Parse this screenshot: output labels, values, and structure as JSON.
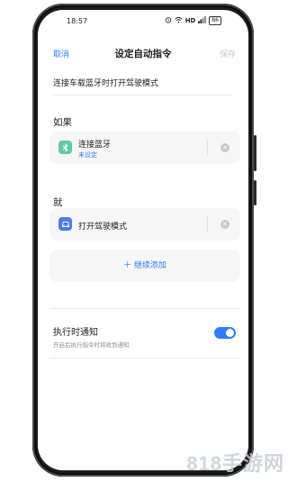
{
  "status_bar": {
    "time": "18:57",
    "network": "HD",
    "battery": "86"
  },
  "header": {
    "cancel_label": "取消",
    "title": "设定自动指令",
    "save_label": "保存"
  },
  "command_name": {
    "value": "连接车载蓝牙时打开驾驶模式"
  },
  "condition": {
    "section_label": "如果",
    "item": {
      "title": "连接蓝牙",
      "subtitle": "未设定",
      "icon": "bluetooth-icon",
      "icon_color": "#5fc9a3"
    }
  },
  "action": {
    "section_label": "就",
    "item": {
      "title": "打开驾驶模式",
      "icon": "car-icon",
      "icon_color": "#4a7de8"
    },
    "add_label": "＋ 继续添加"
  },
  "notify": {
    "title": "执行时通知",
    "subtitle": "开启后执行指令时将收到通知",
    "enabled": true
  },
  "colors": {
    "accent": "#2e7df6",
    "card_bg": "#f6f6f7"
  },
  "watermark": "818手游网"
}
